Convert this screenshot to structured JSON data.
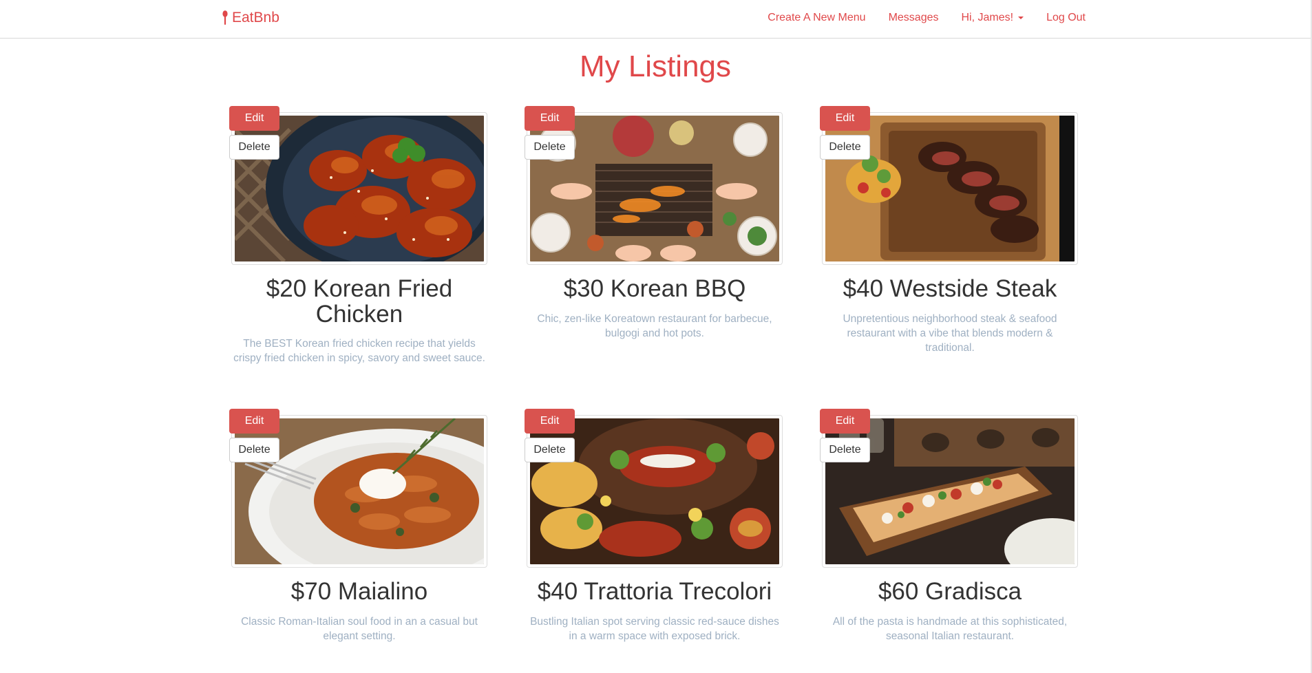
{
  "navbar": {
    "brand": "EatBnb",
    "links": {
      "create": "Create A New Menu",
      "messages": "Messages",
      "user": "Hi, James!",
      "logout": "Log Out"
    }
  },
  "page": {
    "title": "My Listings"
  },
  "listings": [
    {
      "title": "$20 Korean Fried Chicken",
      "description": "The BEST Korean fried chicken recipe that yields crispy fried chicken in spicy, savory and sweet sauce.",
      "edit": "Edit",
      "delete": "Delete"
    },
    {
      "title": "$30 Korean BBQ",
      "description": "Chic, zen-like Koreatown restaurant for barbecue, bulgogi and hot pots.",
      "edit": "Edit",
      "delete": "Delete"
    },
    {
      "title": "$40 Westside Steak",
      "description": "Unpretentious neighborhood steak & seafood restaurant with a vibe that blends modern & traditional.",
      "edit": "Edit",
      "delete": "Delete"
    },
    {
      "title": "$70 Maialino",
      "description": "Classic Roman-Italian soul food in an a casual but elegant setting.",
      "edit": "Edit",
      "delete": "Delete"
    },
    {
      "title": "$40 Trattoria Trecolori",
      "description": "Bustling Italian spot serving classic red-sauce dishes in a warm space with exposed brick.",
      "edit": "Edit",
      "delete": "Delete"
    },
    {
      "title": "$60 Gradisca",
      "description": "All of the pasta is handmade at this sophisticated, seasonal Italian restaurant.",
      "edit": "Edit",
      "delete": "Delete"
    }
  ],
  "colors": {
    "brand": "#e0484a",
    "edit_button": "#d9534f",
    "description_text": "#9fb0c2",
    "title_text": "#333333"
  },
  "icons": {
    "brand": "spoon-icon"
  }
}
